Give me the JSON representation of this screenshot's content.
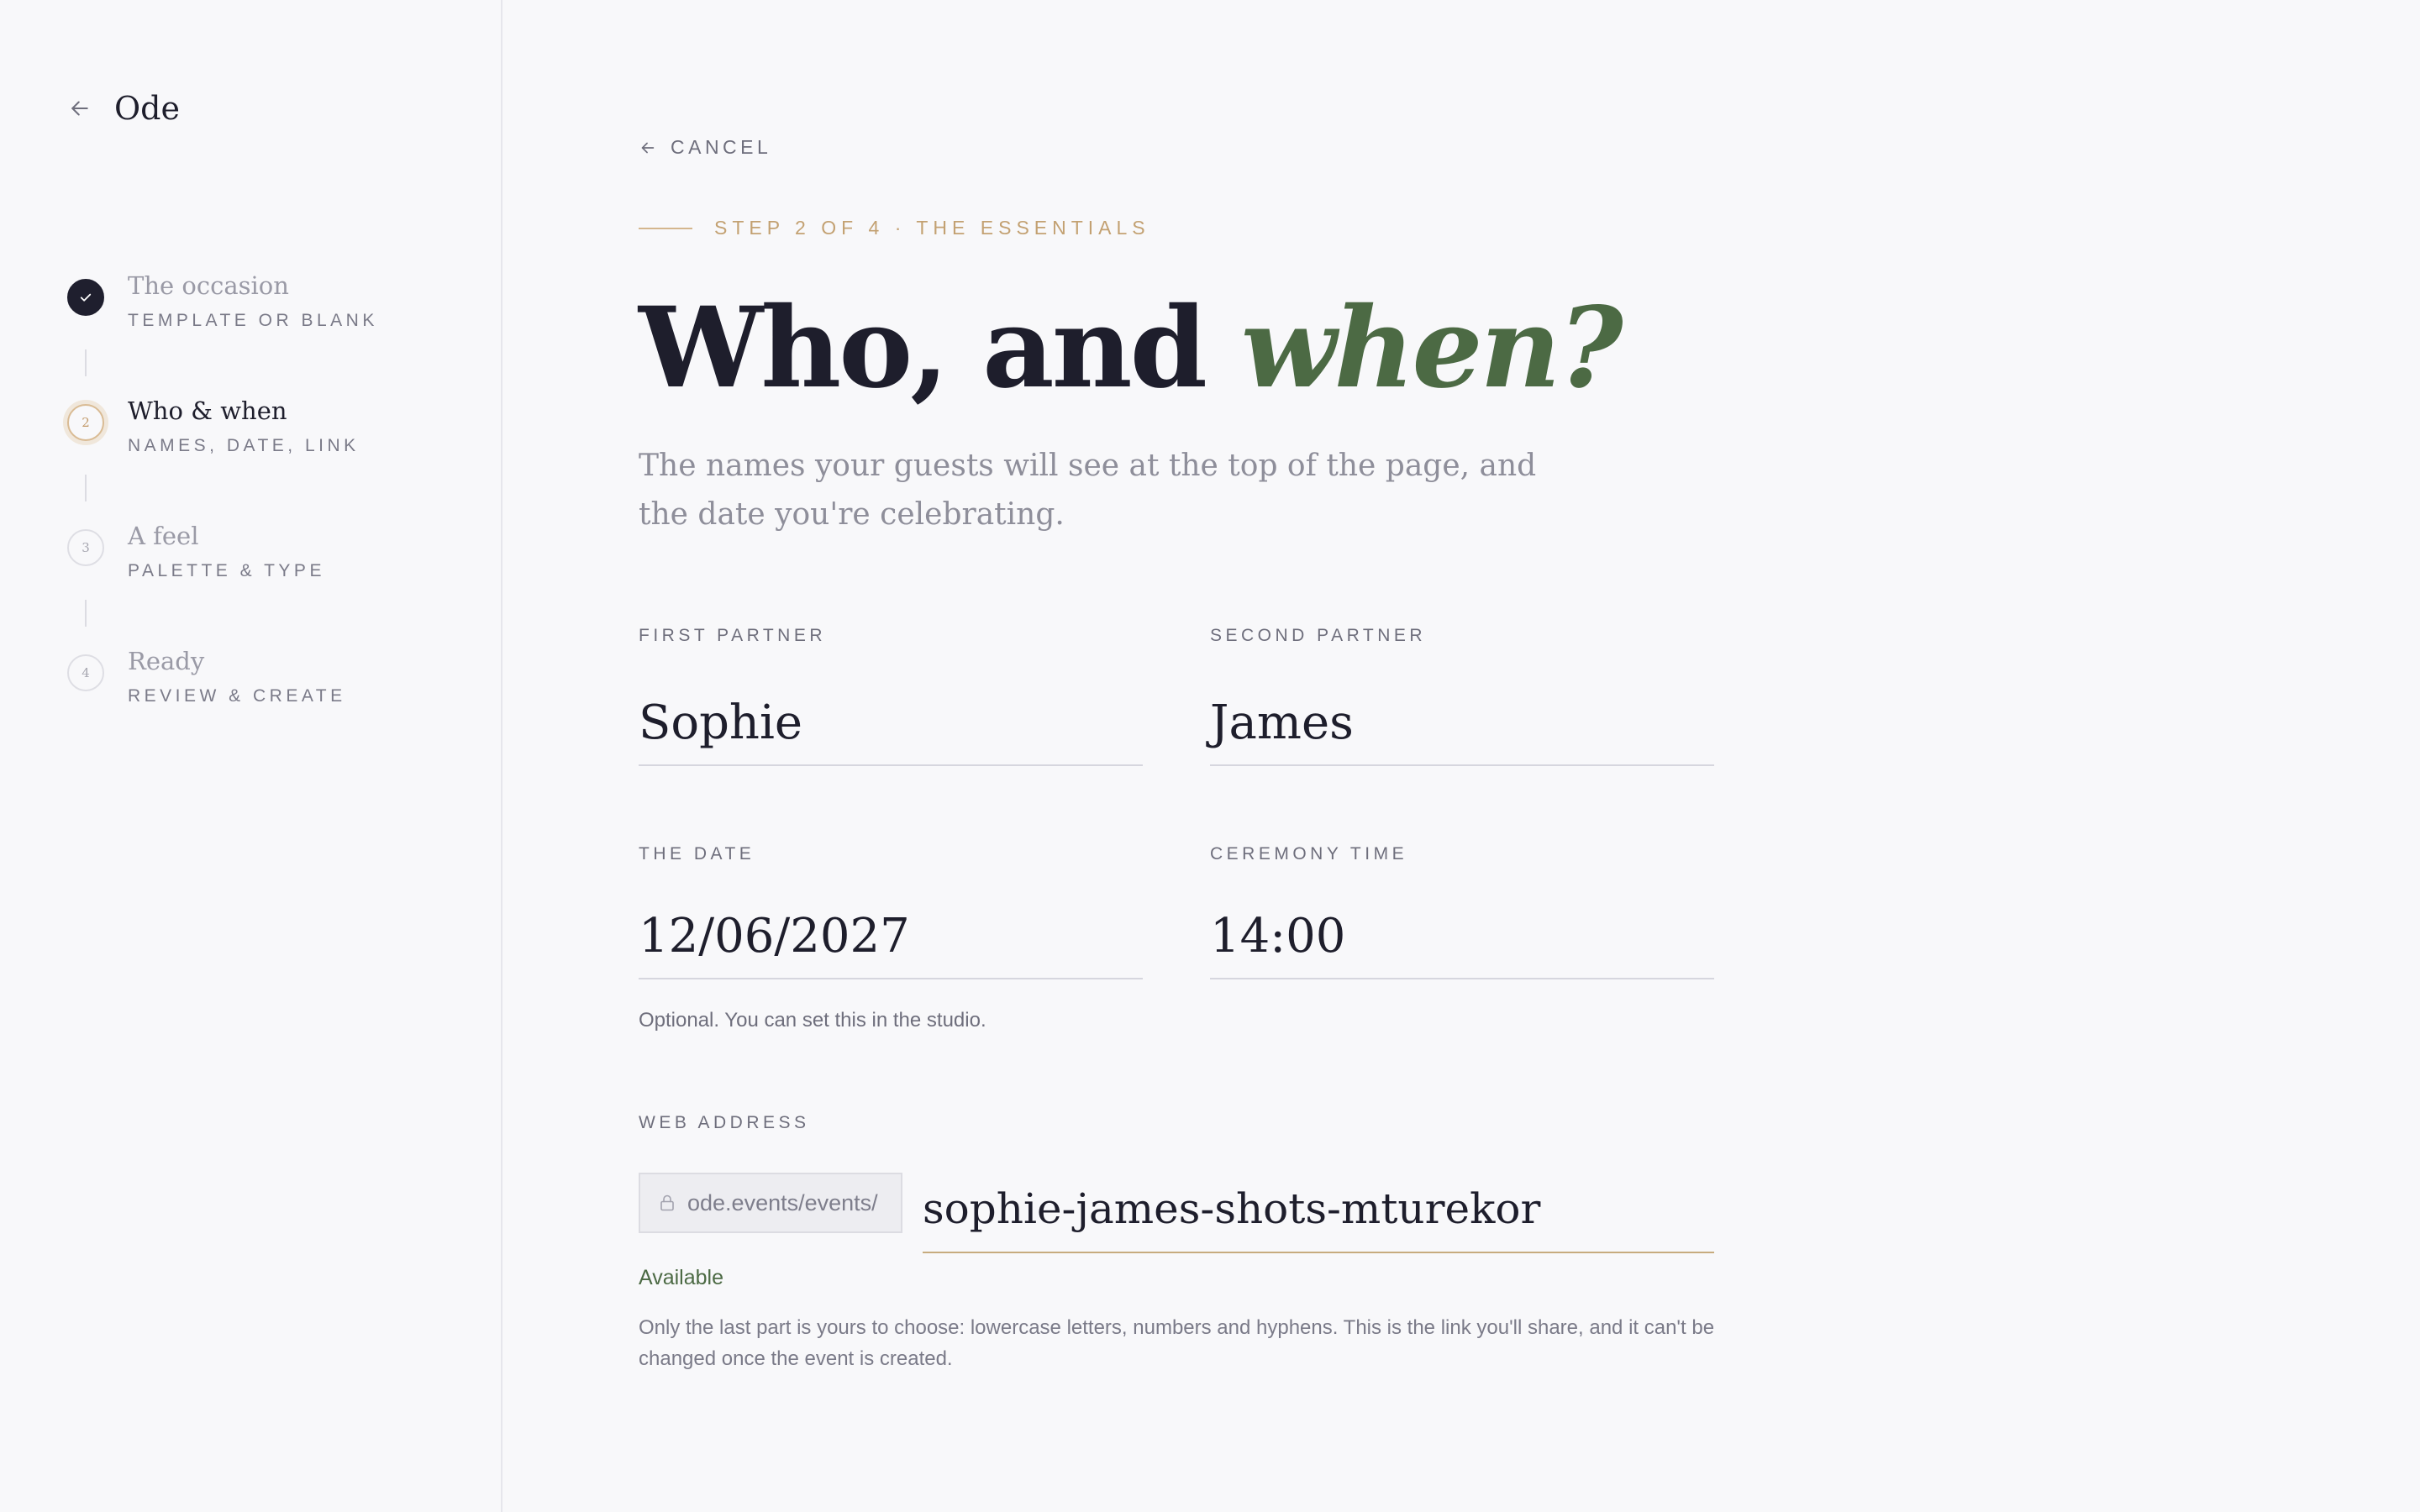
{
  "app": {
    "name": "Ode",
    "back_icon": "arrow-left-icon"
  },
  "steps": [
    {
      "number": "1",
      "title": "The occasion",
      "subtitle": "TEMPLATE OR BLANK",
      "state": "done"
    },
    {
      "number": "2",
      "title": "Who & when",
      "subtitle": "NAMES, DATE, LINK",
      "state": "active"
    },
    {
      "number": "3",
      "title": "A feel",
      "subtitle": "PALETTE & TYPE",
      "state": "upcoming"
    },
    {
      "number": "4",
      "title": "Ready",
      "subtitle": "REVIEW & CREATE",
      "state": "upcoming"
    }
  ],
  "header": {
    "cancel_label": "CANCEL",
    "eyebrow": "STEP 2 OF 4 · THE ESSENTIALS",
    "title_main": "Who, and ",
    "title_accent": "when?",
    "lead": "The names your guests will see at the top of the page, and the date you're celebrating."
  },
  "form": {
    "first_partner": {
      "label": "FIRST PARTNER",
      "value": "Sophie"
    },
    "second_partner": {
      "label": "SECOND PARTNER",
      "value": "James"
    },
    "date": {
      "label": "THE DATE",
      "value": "12/06/2027"
    },
    "time": {
      "label": "CEREMONY TIME",
      "value": "14:00",
      "hint": "Optional. You can set this in the studio."
    },
    "web_address": {
      "label": "WEB ADDRESS",
      "prefix": "ode.events/events/",
      "slug": "sophie-james-shots-mturekor",
      "status": "Available",
      "help": "Only the last part is yours to choose: lowercase letters, numbers and hyphens. This is the link you'll share, and it can't be changed once the event is created."
    }
  },
  "colors": {
    "accent_gold": "#c3a172",
    "accent_green": "#4c6a44",
    "ink": "#1e1e2c",
    "background": "#f8f8fa"
  }
}
